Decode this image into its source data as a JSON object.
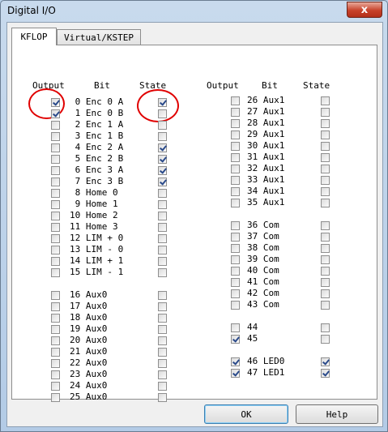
{
  "window": {
    "title": "Digital I/O",
    "close_symbol": "x"
  },
  "tabs": [
    {
      "label": "KFLOP",
      "active": true
    },
    {
      "label": "Virtual/KSTEP",
      "active": false
    }
  ],
  "headers": {
    "output": "Output",
    "bit": "Bit",
    "state": "State"
  },
  "left_groups": [
    [
      {
        "label": " 0 Enc 0 A",
        "output": true,
        "state": true
      },
      {
        "label": " 1 Enc 0 B",
        "output": true,
        "state": false
      },
      {
        "label": " 2 Enc 1 A",
        "output": false,
        "state": false
      },
      {
        "label": " 3 Enc 1 B",
        "output": false,
        "state": false
      },
      {
        "label": " 4 Enc 2 A",
        "output": false,
        "state": true
      },
      {
        "label": " 5 Enc 2 B",
        "output": false,
        "state": true
      },
      {
        "label": " 6 Enc 3 A",
        "output": false,
        "state": true
      },
      {
        "label": " 7 Enc 3 B",
        "output": false,
        "state": true
      },
      {
        "label": " 8 Home 0",
        "output": false,
        "state": false
      },
      {
        "label": " 9 Home 1",
        "output": false,
        "state": false
      },
      {
        "label": "10 Home 2",
        "output": false,
        "state": false
      },
      {
        "label": "11 Home 3",
        "output": false,
        "state": false
      },
      {
        "label": "12 LIM + 0",
        "output": false,
        "state": false
      },
      {
        "label": "13 LIM - 0",
        "output": false,
        "state": false
      },
      {
        "label": "14 LIM + 1",
        "output": false,
        "state": false
      },
      {
        "label": "15 LIM - 1",
        "output": false,
        "state": false
      }
    ],
    [
      {
        "label": "16 Aux0",
        "output": false,
        "state": false
      },
      {
        "label": "17 Aux0",
        "output": false,
        "state": false
      },
      {
        "label": "18 Aux0",
        "output": false,
        "state": false
      },
      {
        "label": "19 Aux0",
        "output": false,
        "state": false
      },
      {
        "label": "20 Aux0",
        "output": false,
        "state": false
      },
      {
        "label": "21 Aux0",
        "output": false,
        "state": false
      },
      {
        "label": "22 Aux0",
        "output": false,
        "state": false
      },
      {
        "label": "23 Aux0",
        "output": false,
        "state": false
      },
      {
        "label": "24 Aux0",
        "output": false,
        "state": false
      },
      {
        "label": "25 Aux0",
        "output": false,
        "state": false
      }
    ]
  ],
  "right_groups": [
    [
      {
        "label": "26 Aux1",
        "output": false,
        "state": false
      },
      {
        "label": "27 Aux1",
        "output": false,
        "state": false
      },
      {
        "label": "28 Aux1",
        "output": false,
        "state": false
      },
      {
        "label": "29 Aux1",
        "output": false,
        "state": false
      },
      {
        "label": "30 Aux1",
        "output": false,
        "state": false
      },
      {
        "label": "31 Aux1",
        "output": false,
        "state": false
      },
      {
        "label": "32 Aux1",
        "output": false,
        "state": false
      },
      {
        "label": "33 Aux1",
        "output": false,
        "state": false
      },
      {
        "label": "34 Aux1",
        "output": false,
        "state": false
      },
      {
        "label": "35 Aux1",
        "output": false,
        "state": false
      }
    ],
    [
      {
        "label": "36 Com",
        "output": false,
        "state": false
      },
      {
        "label": "37 Com",
        "output": false,
        "state": false
      },
      {
        "label": "38 Com",
        "output": false,
        "state": false
      },
      {
        "label": "39 Com",
        "output": false,
        "state": false
      },
      {
        "label": "40 Com",
        "output": false,
        "state": false
      },
      {
        "label": "41 Com",
        "output": false,
        "state": false
      },
      {
        "label": "42 Com",
        "output": false,
        "state": false
      },
      {
        "label": "43 Com",
        "output": false,
        "state": false
      }
    ],
    [
      {
        "label": "44",
        "output": false,
        "state": false
      },
      {
        "label": "45",
        "output": true,
        "state": false
      }
    ],
    [
      {
        "label": "46 LED0",
        "output": true,
        "state": true
      },
      {
        "label": "47 LED1",
        "output": true,
        "state": true
      }
    ]
  ],
  "buttons": {
    "ok": "OK",
    "help": "Help"
  },
  "colors": {
    "annotation_circle": "#e00000",
    "check_mark": "#2a4a8a"
  }
}
